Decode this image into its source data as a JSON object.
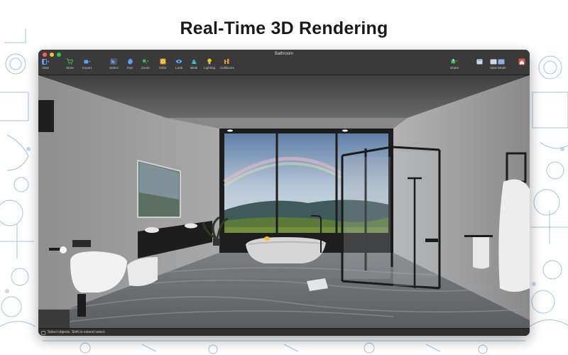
{
  "headline": "Real-Time 3D Rendering",
  "window": {
    "title": "Bathroom",
    "traffic_colors": [
      "#ff5f57",
      "#febc2e",
      "#28c840"
    ]
  },
  "toolbar": {
    "left": [
      {
        "label": "View",
        "icon": "sidebar-icon"
      },
      {
        "label": "Store",
        "icon": "cart-icon"
      },
      {
        "label": "Import",
        "icon": "import-icon"
      },
      {
        "label": "Select",
        "icon": "cursor-icon"
      },
      {
        "label": "Pan",
        "icon": "hand-icon"
      },
      {
        "label": "Zoom",
        "icon": "magnifier-icon"
      },
      {
        "label": "Orbit",
        "icon": "orbit-icon"
      },
      {
        "label": "Look",
        "icon": "eye-icon"
      },
      {
        "label": "Walk",
        "icon": "walk-icon"
      },
      {
        "label": "Lighting",
        "icon": "bulb-icon"
      },
      {
        "label": "Collisions",
        "icon": "collision-icon"
      }
    ],
    "right": [
      {
        "label": "Share",
        "icon": "share-icon"
      },
      {
        "label": "View Mode",
        "icon": "view-mode-icon"
      }
    ]
  },
  "status": {
    "text": "Select objects. Shift to extend select."
  },
  "colors": {
    "accent": "#2f7fd8",
    "blueprint": "#8fb4dc",
    "store_green": "#3fb950",
    "bulb_yellow": "#f5c518"
  }
}
